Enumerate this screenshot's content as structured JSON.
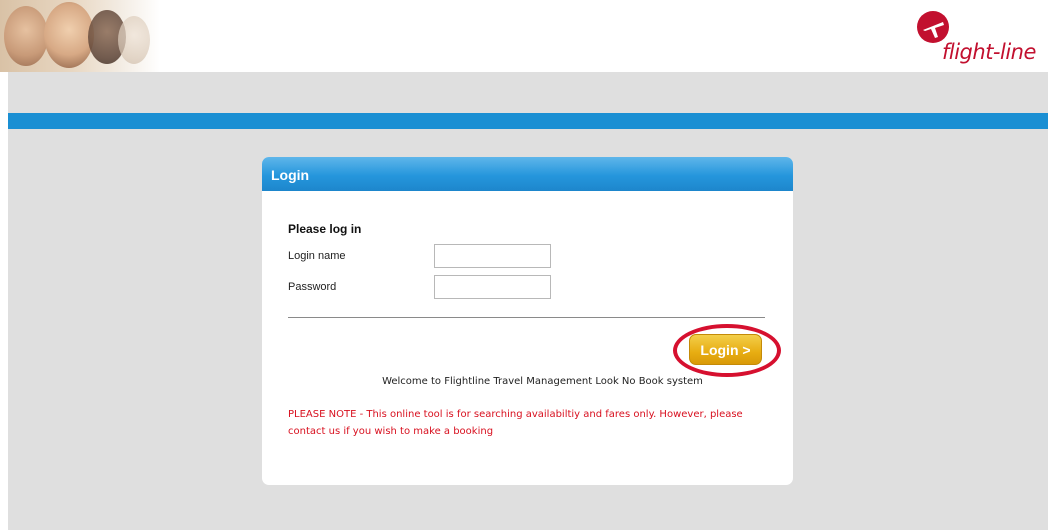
{
  "brand": {
    "logo_text": "flight-line",
    "accent_color": "#c2102f",
    "band_color": "#1a8fd3"
  },
  "panel": {
    "title": "Login",
    "heading": "Please log in",
    "login_name_label": "Login name",
    "password_label": "Password",
    "login_name_value": "",
    "password_value": "",
    "login_button": "Login >",
    "welcome_text": "Welcome to Flightline Travel Management Look No Book system",
    "note_text": "PLEASE NOTE - This online tool is for searching availabiltiy and fares only. However, please contact us if you wish to make a booking"
  },
  "icons": {
    "logo_mark": "airplane-icon",
    "header_image": "people-photo"
  }
}
